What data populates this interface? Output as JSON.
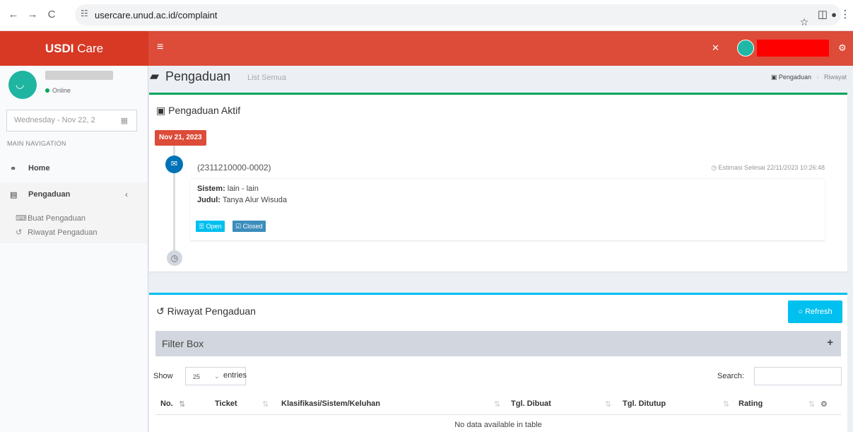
{
  "browser": {
    "back_glyph": "←",
    "forward_glyph": "→",
    "reload_glyph": "C",
    "tune_glyph": "☷",
    "url": "usercare.unud.ac.id/complaint",
    "star_glyph": "☆",
    "sidepanel_glyph": "◫",
    "profile_glyph": "●",
    "menu_glyph": "⋮"
  },
  "header": {
    "logo_bold": "USDI",
    "logo_rest": " Care",
    "menu_glyph": "≡",
    "fullscreen_glyph": "✕",
    "settings_glyph": "⚙",
    "colors": {
      "header_bg": "#dd4b39",
      "logo_bg": "#d73925"
    }
  },
  "sidebar": {
    "status": "Online",
    "date": "Wednesday - Nov 22, 2",
    "calendar_glyph": "▦",
    "nav_header": "MAIN NAVIGATION",
    "items": [
      {
        "label": "Home",
        "icon": "dashboard-icon",
        "glyph": "⚭"
      },
      {
        "label": "Pengaduan",
        "icon": "list-icon",
        "glyph": "▤",
        "chevron": "‹"
      }
    ],
    "sub_items": [
      {
        "label": "Buat Pengaduan",
        "icon": "comment-icon",
        "glyph": "⌨"
      },
      {
        "label": "Riwayat Pengaduan",
        "icon": "history-icon",
        "glyph": "↺"
      }
    ]
  },
  "content": {
    "title_glyph": "▰",
    "title": "Pengaduan",
    "subtitle": "List Semua",
    "breadcrumb": {
      "glyph": "▣",
      "first": "Pengaduan",
      "sep": "›",
      "second": "Riwayat"
    }
  },
  "active_box": {
    "title_glyph": "▣",
    "title": "Pengaduan Aktif",
    "time_label": "Nov 21, 2023",
    "envelope_glyph": "✉",
    "clock_glyph": "◷",
    "ticket": "(2311210000-0002)",
    "estimate": "◷ Estimasi Selesai 22/11/2023 10:26:48",
    "sistem_label": "Sistem:",
    "sistem_value": " lain - lain",
    "judul_label": "Judul:",
    "judul_value": " Tanya Alur Wisuda",
    "open_btn": "☰ Open",
    "closed_btn": "☑ Closed"
  },
  "history_box": {
    "title_glyph": "↺",
    "title": "Riwayat Pengaduan",
    "refresh_label": "○ Refresh",
    "filter_title": "Filter Box",
    "filter_plus": "+",
    "show_label": "Show",
    "entries_value": "25",
    "entries_arrow": "⌄",
    "entries_label": "entries",
    "search_label": "Search:",
    "sort_glyph": "⇅",
    "gear_glyph": "⚙",
    "columns": [
      "No.",
      "Ticket",
      "Klasifikasi/Sistem/Keluhan",
      "Tgl. Dibuat",
      "Tgl. Ditutup",
      "Rating"
    ],
    "empty_message": "No data available in table"
  }
}
